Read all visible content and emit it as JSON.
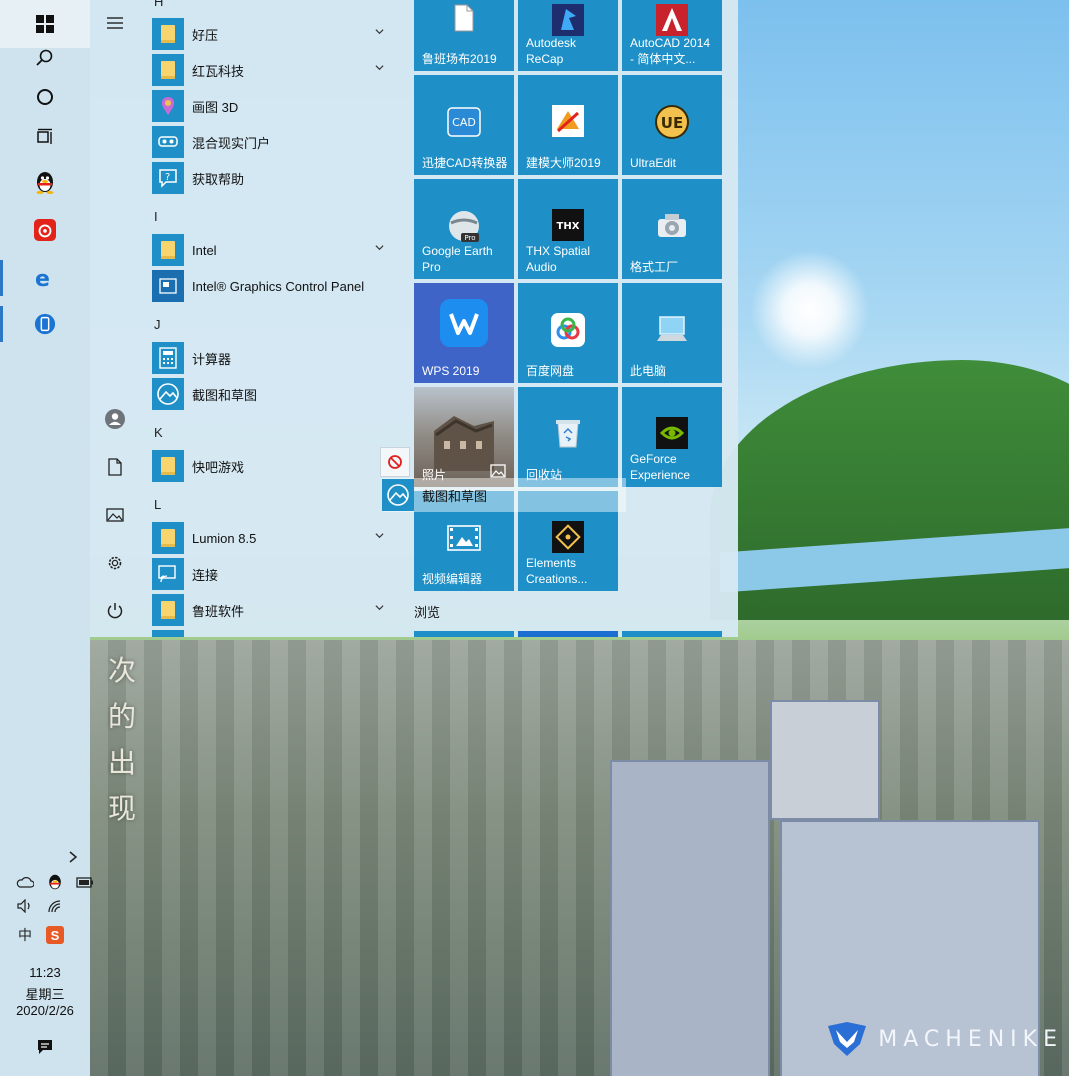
{
  "taskbar": {
    "pinned": [
      {
        "name": "start-button",
        "icon": "windows-logo-icon"
      },
      {
        "name": "search-button",
        "icon": "search-icon"
      },
      {
        "name": "cortana-button",
        "icon": "cortana-circle-icon"
      },
      {
        "name": "task-view-button",
        "icon": "task-view-icon"
      },
      {
        "name": "qq-taskbar-button",
        "icon": "qq-penguin-icon"
      },
      {
        "name": "netease-music-taskbar-button",
        "icon": "netease-music-icon"
      },
      {
        "name": "edge-taskbar-button",
        "icon": "edge-icon"
      },
      {
        "name": "your-phone-taskbar-button",
        "icon": "phone-icon"
      }
    ],
    "tray": {
      "icons": [
        "chevron-right-icon",
        "onedrive-cloud-icon",
        "qq-tray-icon",
        "battery-icon",
        "volume-icon",
        "wifi-icon",
        "ime-icon",
        "sogou-icon"
      ],
      "ime_label": "中",
      "sogou_label": "S"
    },
    "clock": {
      "time": "11:23",
      "weekday": "星期三",
      "date": "2020/2/26"
    },
    "notification_icon": "action-center-icon"
  },
  "start_menu": {
    "rail": [
      "hamburger-icon",
      "user-icon",
      "documents-icon",
      "pictures-icon",
      "settings-icon",
      "power-icon"
    ],
    "letters": {
      "H": "H",
      "I": "I",
      "J": "J",
      "K": "K",
      "L": "L"
    },
    "apps": {
      "haozip": "好压",
      "hongwa": "红瓦科技",
      "paint3d": "画图 3D",
      "mixed_reality": "混合现实门户",
      "get_help": "获取帮助",
      "intel": "Intel",
      "intel_graphics": "Intel® Graphics Control Panel",
      "calculator": "计算器",
      "snip_sketch": "截图和草图",
      "kuaiba": "快吧游戏",
      "lumion": "Lumion 8.5",
      "connect": "连接",
      "luban": "鲁班软件"
    },
    "tiles": {
      "luban_site": "鲁班场布2019",
      "recap": "Autodesk\nReCap",
      "autocad": "AutoCAD 2014\n- 简体中文...",
      "xunjie_cad": "迅捷CAD转换器",
      "jianmo": "建模大师2019",
      "ultraedit": "UltraEdit",
      "google_earth": "Google Earth\nPro",
      "thx": "THX Spatial\nAudio",
      "format_factory": "格式工厂",
      "wps": "WPS 2019",
      "baidu_pan": "百度网盘",
      "this_pc": "此电脑",
      "photos": "照片",
      "recycle_bin": "回收站",
      "geforce": "GeForce\nExperience",
      "video_editor": "视频编辑器",
      "elements": "Elements\nCreations..."
    },
    "cad_badge": "CAD",
    "ue_badge": "UE",
    "thx_badge": "THX",
    "pro_badge": "Pro",
    "drag_ghost_label": "截图和草图",
    "group_label": "浏览"
  },
  "wallpaper": {
    "poem": "次的出现",
    "brand": "MACHENIKE"
  },
  "colors": {
    "tile_blue": "#1e90c7",
    "wps_tile": "#3f64c8",
    "taskbar_bg": "#cfe3ee",
    "menu_bg": "#d6e8f3"
  }
}
